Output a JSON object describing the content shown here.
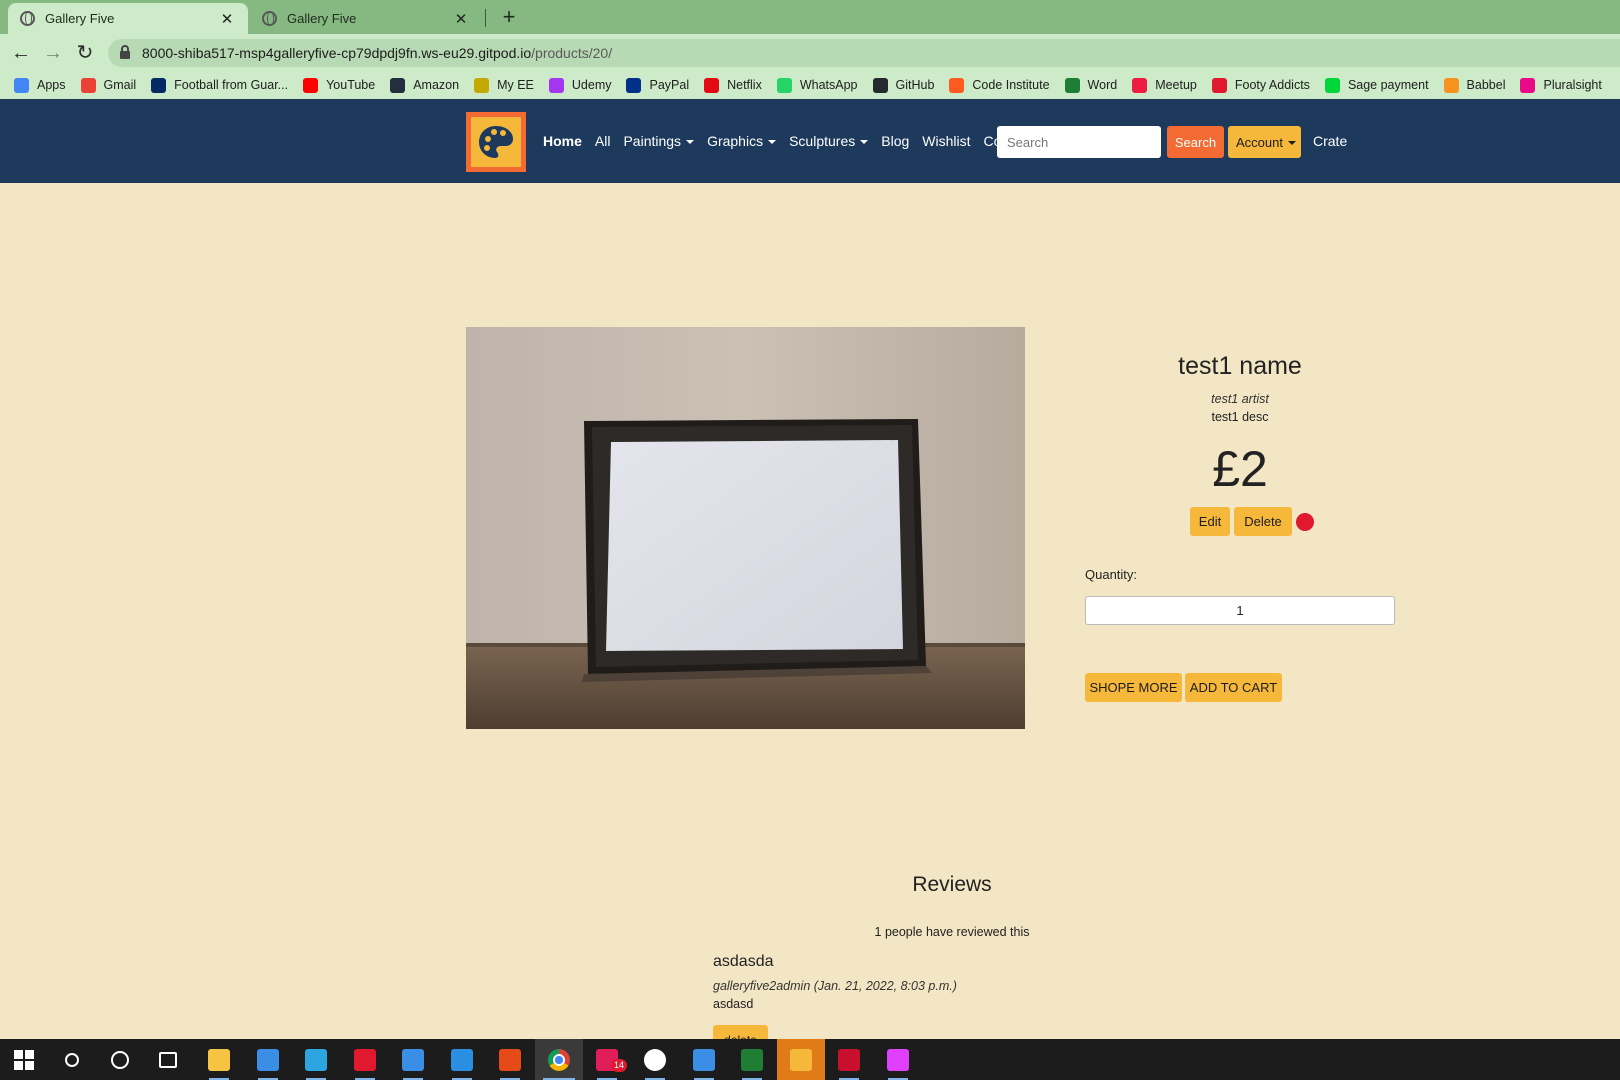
{
  "browser": {
    "tabs": [
      {
        "title": "Gallery Five",
        "active": true
      },
      {
        "title": "Gallery Five",
        "active": false
      }
    ],
    "close_glyph": "✕",
    "new_tab_glyph": "+",
    "url_host": "8000-shiba517-msp4galleryfive-cp79dpdj9fn.ws-eu29.gitpod.io",
    "url_path": "/products/20/",
    "bookmarks": [
      {
        "label": "Apps",
        "icon": "apps-grid-icon",
        "color": "#4285f4"
      },
      {
        "label": "Gmail",
        "icon": "gmail-icon",
        "color": "#ea4335"
      },
      {
        "label": "Football from Guar...",
        "icon": "guardian-icon",
        "color": "#052962"
      },
      {
        "label": "YouTube",
        "icon": "youtube-icon",
        "color": "#ff0000"
      },
      {
        "label": "Amazon",
        "icon": "amazon-icon",
        "color": "#232f3e"
      },
      {
        "label": "My EE",
        "icon": "ee-icon",
        "color": "#c5a800"
      },
      {
        "label": "Udemy",
        "icon": "udemy-icon",
        "color": "#a435f0"
      },
      {
        "label": "PayPal",
        "icon": "paypal-icon",
        "color": "#003087"
      },
      {
        "label": "Netflix",
        "icon": "netflix-icon",
        "color": "#e50914"
      },
      {
        "label": "WhatsApp",
        "icon": "whatsapp-icon",
        "color": "#25d366"
      },
      {
        "label": "GitHub",
        "icon": "github-icon",
        "color": "#24292e"
      },
      {
        "label": "Code Institute",
        "icon": "code-institute-icon",
        "color": "#ff5a1f"
      },
      {
        "label": "Word",
        "icon": "word-icon",
        "color": "#1e7e34"
      },
      {
        "label": "Meetup",
        "icon": "meetup-icon",
        "color": "#ed1c40"
      },
      {
        "label": "Footy Addicts",
        "icon": "footy-addicts-icon",
        "color": "#e0192e"
      },
      {
        "label": "Sage payment",
        "icon": "sage-icon",
        "color": "#00d639"
      },
      {
        "label": "Babbel",
        "icon": "babbel-icon",
        "color": "#f7931e"
      },
      {
        "label": "Pluralsight",
        "icon": "pluralsight-icon",
        "color": "#e80a89"
      }
    ]
  },
  "site": {
    "colors": {
      "navbar": "#1d3a5c",
      "accent_orange": "#f36b32",
      "accent_yellow": "#f6b83a",
      "page_bg": "#f2e6c4"
    },
    "nav": {
      "home": "Home",
      "all": "All",
      "paintings": "Paintings",
      "graphics": "Graphics",
      "sculptures": "Sculptures",
      "blog": "Blog",
      "wishlist": "Wishlist",
      "contact": "Contact"
    },
    "search_placeholder": "Search",
    "search_button": "Search",
    "account_button": "Account",
    "crate_link": "Crate"
  },
  "product": {
    "name": "test1 name",
    "artist": "test1 artist",
    "description": "test1 desc",
    "price": "£2",
    "edit_label": "Edit",
    "delete_label": "Delete",
    "quantity_label": "Quantity:",
    "quantity_value": "1",
    "shop_more_label": "SHOPE MORE",
    "add_to_cart_label": "ADD TO CART"
  },
  "reviews": {
    "heading": "Reviews",
    "count_text": "1 people have reviewed this",
    "items": [
      {
        "title": "asdasda",
        "meta": "galleryfive2admin (Jan. 21, 2022, 8:03 p.m.)",
        "body": "asdasd",
        "delete_label": "delete"
      }
    ]
  },
  "taskbar": {
    "badge_count": "14",
    "items": [
      {
        "icon": "windows-start-icon",
        "color": "#ffffff"
      },
      {
        "icon": "search-icon",
        "color": "#ffffff"
      },
      {
        "icon": "cortana-icon",
        "color": "#ffffff"
      },
      {
        "icon": "task-view-icon",
        "color": "#ffffff"
      },
      {
        "icon": "file-explorer-icon",
        "color": "#f6c342"
      },
      {
        "icon": "microsoft-store-icon",
        "color": "#3b8ee6"
      },
      {
        "icon": "edge-icon",
        "color": "#2ca5e0"
      },
      {
        "icon": "gift-icon",
        "color": "#e0192e"
      },
      {
        "icon": "mail-icon",
        "color": "#3b8ee6"
      },
      {
        "icon": "vscode-icon",
        "color": "#2a8ee3"
      },
      {
        "icon": "office-icon",
        "color": "#e64a19"
      },
      {
        "icon": "chrome-icon",
        "color": "#4caf50"
      },
      {
        "icon": "slack-icon",
        "color": "#e01e5a"
      },
      {
        "icon": "emoji-app-icon",
        "color": "#ffffff"
      },
      {
        "icon": "photos-icon",
        "color": "#3b8ee6"
      },
      {
        "icon": "excel-icon",
        "color": "#1e7e34"
      },
      {
        "icon": "security-shield-icon",
        "color": "#f6b83a"
      },
      {
        "icon": "mcafee-icon",
        "color": "#c8102e"
      },
      {
        "icon": "paint-drop-icon",
        "color": "#e040fb"
      }
    ]
  }
}
